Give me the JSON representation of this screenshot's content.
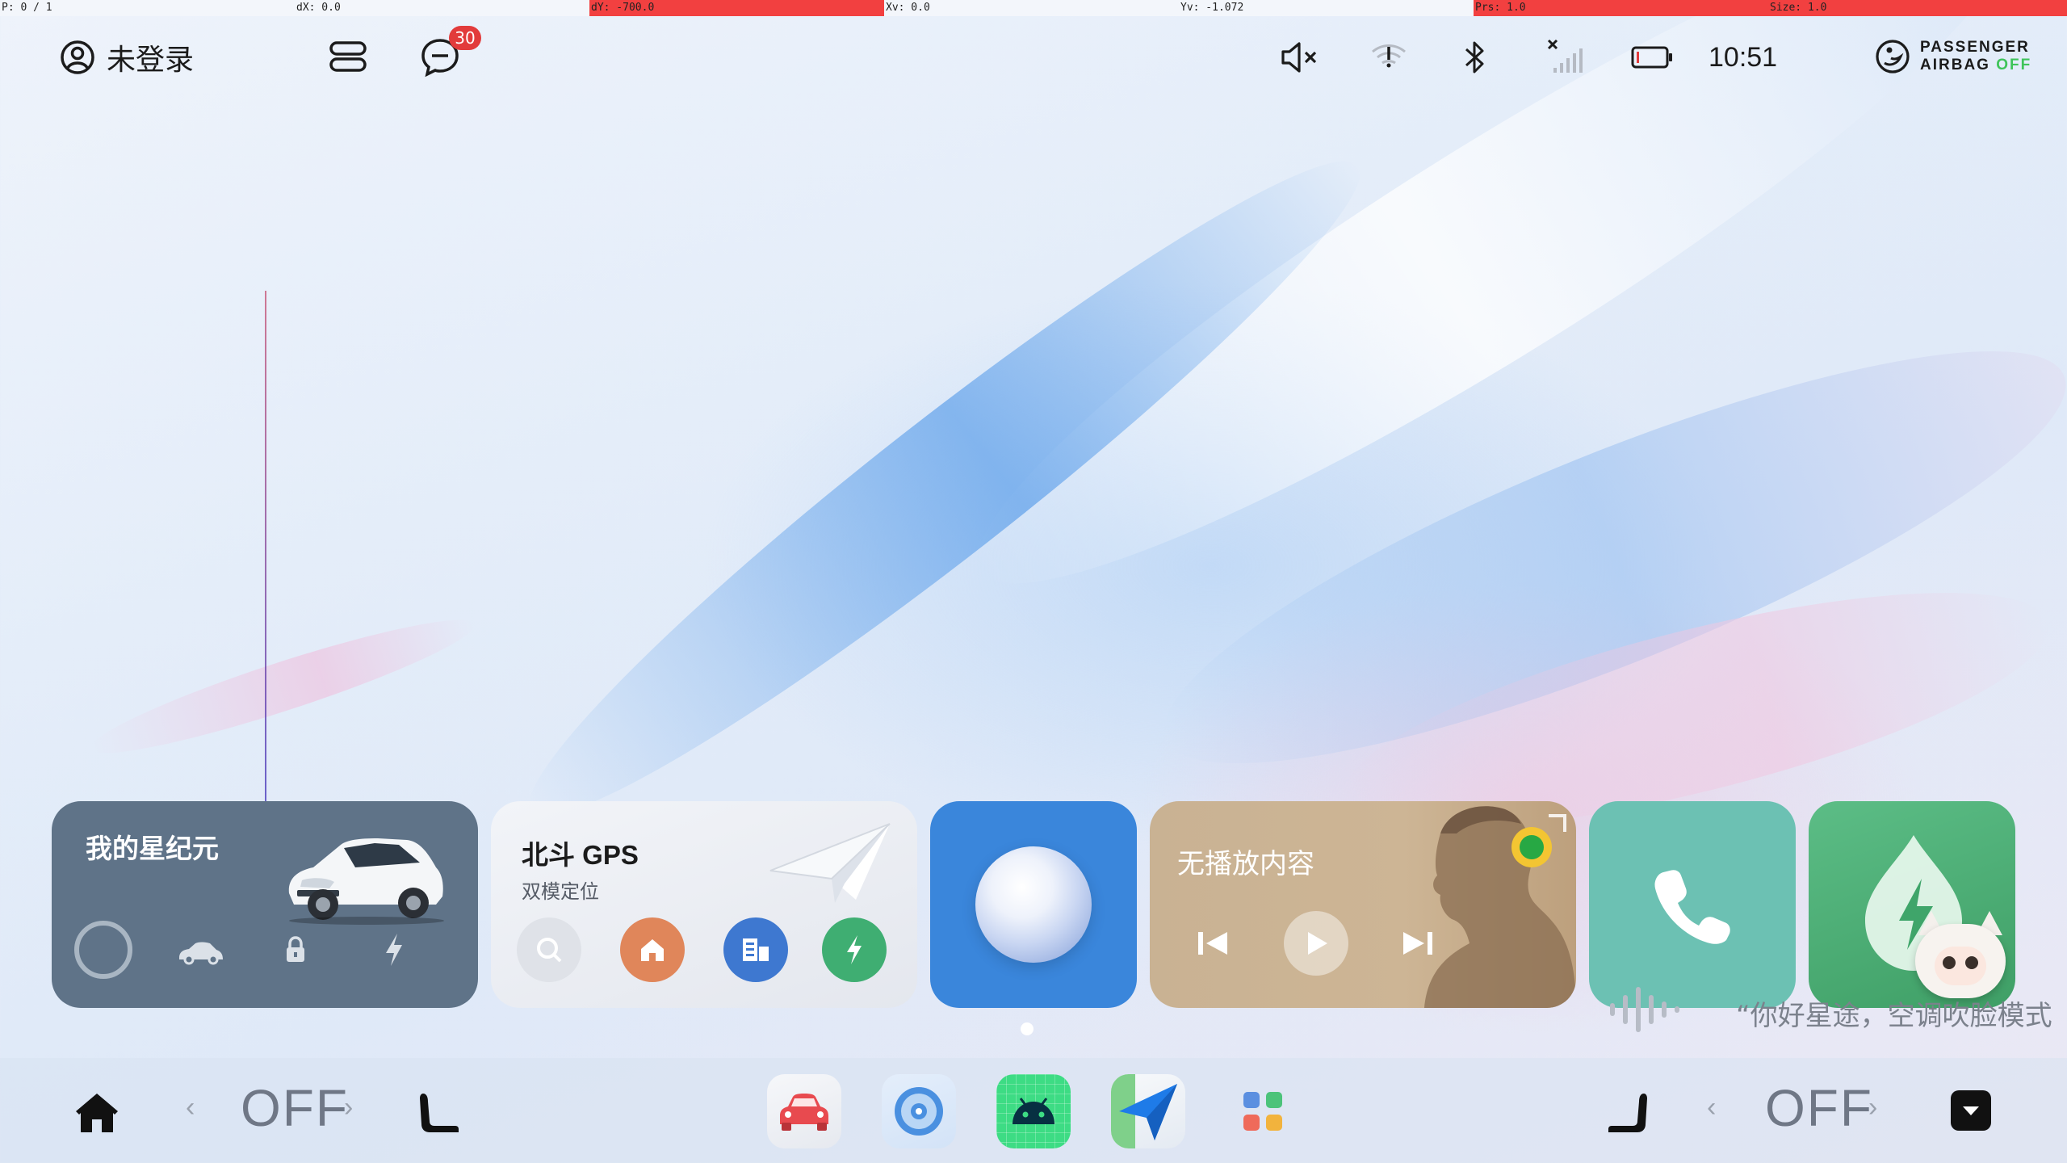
{
  "debug": {
    "pointer": "P: 0 / 1",
    "dx": "dX: 0.0",
    "dy": "dY: -700.0",
    "xv": "Xv: 0.0",
    "yv": "Yv: -1.072",
    "prs": "Prs: 1.0",
    "size": "Size: 1.0"
  },
  "status_bar": {
    "login_label": "未登录",
    "notification_count": "30",
    "time": "10:51",
    "airbag_line1": "PASSENGER",
    "airbag_line2": "AIRBAG",
    "airbag_state": "OFF"
  },
  "cards": {
    "vehicle": {
      "title": "我的星纪元"
    },
    "nav": {
      "title": "北斗 GPS",
      "subtitle": "双模定位"
    },
    "media": {
      "title": "无播放内容"
    }
  },
  "voice": {
    "hint": "“你好星途，空调吹脸模式"
  },
  "dock": {
    "left_temp": "OFF",
    "right_temp": "OFF"
  },
  "colors": {
    "vehicle_card": "#5f7388",
    "nav_card": "#e6e9ef",
    "assistant_card": "#3a86db",
    "media_card": "#cdb595",
    "phone_card": "#6cc1b3",
    "energy_card": "#4fb47a",
    "badge": "#e23b3b"
  }
}
